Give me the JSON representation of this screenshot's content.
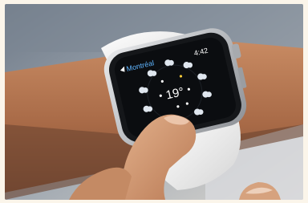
{
  "watch": {
    "location_label": "Montréal",
    "time": "4:42",
    "temperature": "19°"
  },
  "colors": {
    "background": "#fbf5ea",
    "band": "#eeeeee",
    "screen": "#0b0d10",
    "skin": "#b97a55"
  },
  "icons": [
    "cloud-icon",
    "sun-icon",
    "location-arrow-icon"
  ]
}
